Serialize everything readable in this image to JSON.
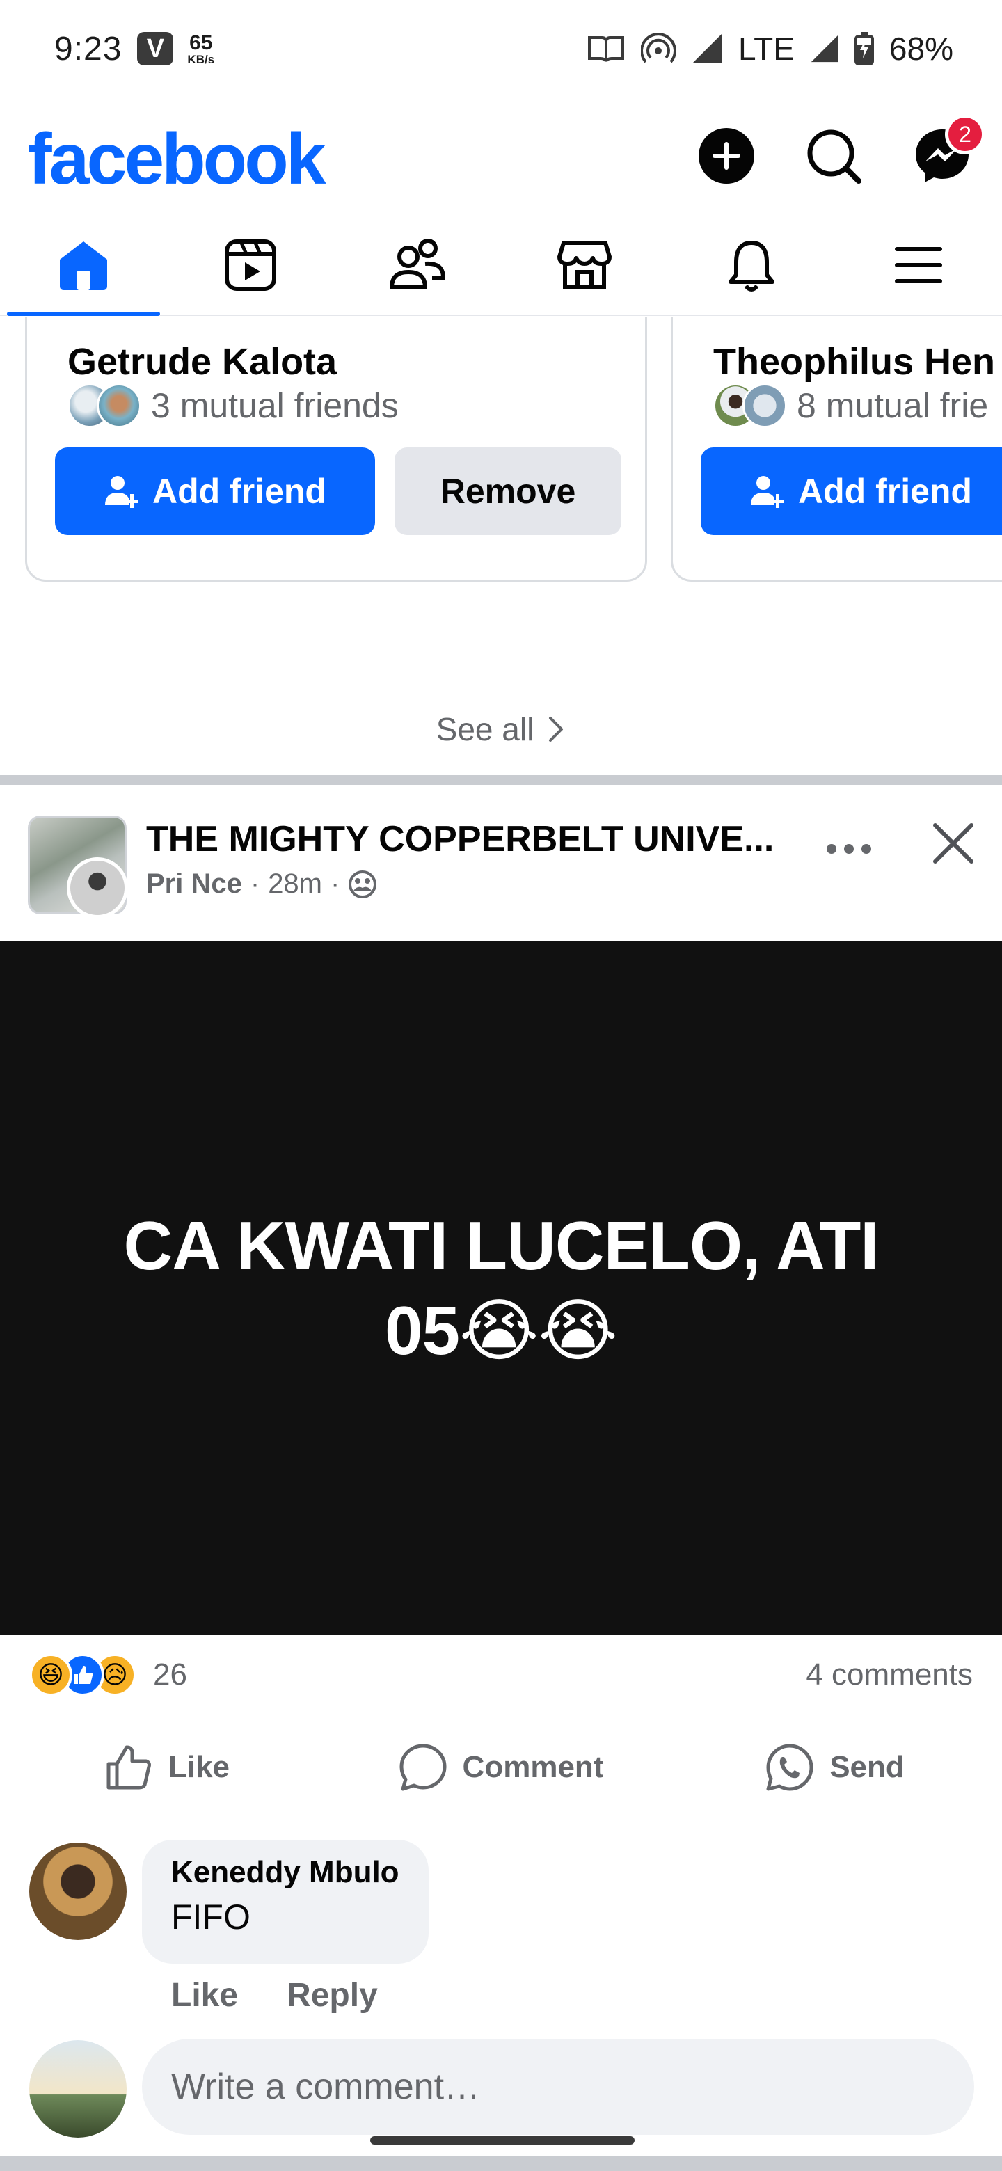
{
  "status_bar": {
    "time": "9:23",
    "carrier_badge": "V",
    "speed_value": "65",
    "speed_unit": "KB/s",
    "network": "LTE",
    "battery": "68%"
  },
  "header": {
    "logo": "facebook",
    "messenger_badge": "2",
    "icons": [
      "plus-icon",
      "search-icon",
      "messenger-icon"
    ]
  },
  "tabs": [
    {
      "name": "home",
      "icon": "home-icon",
      "active": true
    },
    {
      "name": "video",
      "icon": "video-icon",
      "active": false
    },
    {
      "name": "friends",
      "icon": "friends-icon",
      "active": false
    },
    {
      "name": "marketplace",
      "icon": "marketplace-icon",
      "active": false
    },
    {
      "name": "notifications",
      "icon": "bell-icon",
      "active": false
    },
    {
      "name": "menu",
      "icon": "menu-icon",
      "active": false
    }
  ],
  "people_you_may_know": {
    "cards": [
      {
        "name": "Getrude Kalota",
        "mutual": "3 mutual friends",
        "add_label": "Add friend",
        "remove_label": "Remove"
      },
      {
        "name": "Theophilus Hen",
        "mutual": "8 mutual frie",
        "add_label": "Add friend"
      }
    ],
    "see_all": "See all"
  },
  "post": {
    "group_title": "THE MIGHTY COPPERBELT UNIVE...",
    "author": "Pri Nce",
    "time": "28m",
    "text": "CA KWATI LUCELO, ATI 05😭😭",
    "reaction_count": "26",
    "comment_count": "4 comments",
    "actions": {
      "like": "Like",
      "comment": "Comment",
      "send": "Send"
    },
    "comment": {
      "author": "Keneddy Mbulo",
      "text": "FIFO",
      "like": "Like",
      "reply": "Reply"
    },
    "write_placeholder": "Write a comment…"
  },
  "colors": {
    "brand": "#0866ff",
    "badge": "#e41e3f",
    "muted_text": "#65676b",
    "post_bg": "#111111"
  }
}
